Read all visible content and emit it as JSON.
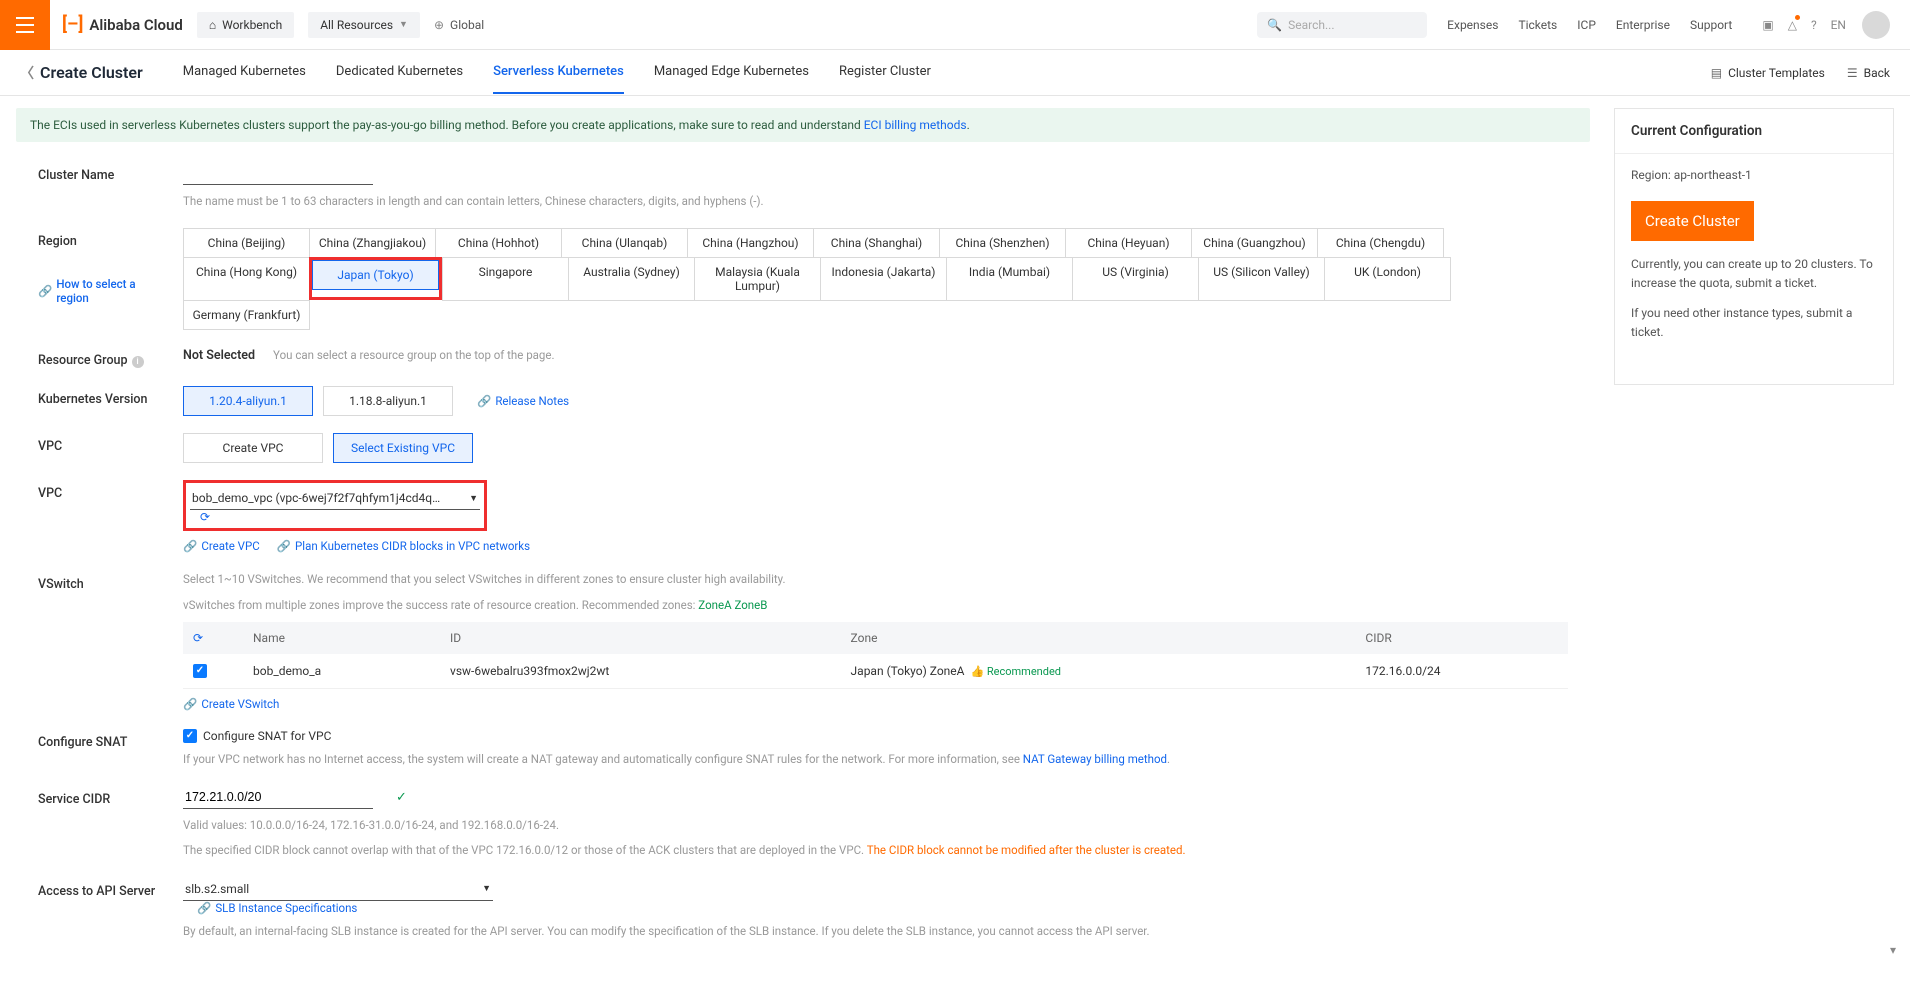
{
  "header": {
    "brand": "Alibaba Cloud",
    "workbench": "Workbench",
    "all_resources": "All Resources",
    "global": "Global",
    "search_placeholder": "Search...",
    "links": {
      "expenses": "Expenses",
      "tickets": "Tickets",
      "icp": "ICP",
      "enterprise": "Enterprise",
      "support": "Support"
    },
    "lang": "EN"
  },
  "tabbar": {
    "back_title": "Create Cluster",
    "tabs": {
      "managed": "Managed Kubernetes",
      "dedicated": "Dedicated Kubernetes",
      "serverless": "Serverless Kubernetes",
      "edge": "Managed Edge Kubernetes",
      "register": "Register Cluster"
    },
    "right": {
      "templates": "Cluster Templates",
      "back": "Back"
    }
  },
  "banner": {
    "text_pre": "The ECIs used in serverless Kubernetes clusters support the pay-as-you-go billing method. Before you create applications, make sure to read and understand ",
    "link": "ECI billing methods",
    "dot": "."
  },
  "form": {
    "cluster_name": {
      "label": "Cluster Name",
      "hint": "The name must be 1 to 63 characters in length and can contain letters, Chinese characters, digits, and hyphens (-)."
    },
    "region": {
      "label": "Region",
      "help_link": "How to select a region",
      "options": [
        "China (Beijing)",
        "China (Zhangjiakou)",
        "China (Hohhot)",
        "China (Ulanqab)",
        "China (Hangzhou)",
        "China (Shanghai)",
        "China (Shenzhen)",
        "China (Heyuan)",
        "China (Guangzhou)",
        "China (Chengdu)",
        "China (Hong Kong)",
        "Japan (Tokyo)",
        "Singapore",
        "Australia (Sydney)",
        "Malaysia (Kuala Lumpur)",
        "Indonesia (Jakarta)",
        "India (Mumbai)",
        "US (Virginia)",
        "US (Silicon Valley)",
        "UK (London)",
        "Germany (Frankfurt)"
      ],
      "selected": "Japan (Tokyo)"
    },
    "resource_group": {
      "label": "Resource Group",
      "value": "Not Selected",
      "hint": "You can select a resource group on the top of the page."
    },
    "k8s_version": {
      "label": "Kubernetes Version",
      "options": [
        "1.20.4-aliyun.1",
        "1.18.8-aliyun.1"
      ],
      "selected": "1.20.4-aliyun.1",
      "release_notes": "Release Notes"
    },
    "vpc_mode": {
      "label": "VPC",
      "options": [
        "Create VPC",
        "Select Existing VPC"
      ],
      "selected": "Select Existing VPC"
    },
    "vpc_select": {
      "label": "VPC",
      "value": "bob_demo_vpc (vpc-6wej7f2f7qhfym1j4cd4q, 172.16....",
      "create_link": "Create VPC",
      "plan_link": "Plan Kubernetes CIDR blocks in VPC networks"
    },
    "vswitch": {
      "label": "VSwitch",
      "hint1": "Select 1~10 VSwitches. We recommend that you select VSwitches in different zones to ensure cluster high availability.",
      "hint2_pre": "vSwitches from multiple zones improve the success rate of resource creation. Recommended zones: ",
      "zonea": "ZoneA",
      "zoneb": "ZoneB",
      "th_name": "Name",
      "th_id": "ID",
      "th_zone": "Zone",
      "th_cidr": "CIDR",
      "row": {
        "name": "bob_demo_a",
        "id": "vsw-6webalru393fmox2wj2wt",
        "zone": "Japan (Tokyo) ZoneA",
        "rec": "Recommended",
        "cidr": "172.16.0.0/24"
      },
      "create_link": "Create VSwitch"
    },
    "snat": {
      "label": "Configure SNAT",
      "check_label": "Configure SNAT for VPC",
      "hint_pre": "If your VPC network has no Internet access, the system will create a NAT gateway and automatically configure SNAT rules for the network. For more information, see ",
      "hint_link": "NAT Gateway billing method",
      "hint_dot": "."
    },
    "service_cidr": {
      "label": "Service CIDR",
      "value": "172.21.0.0/20",
      "hint1": "Valid values: 10.0.0.0/16-24, 172.16-31.0.0/16-24, and 192.168.0.0/16-24.",
      "hint2_pre": "The specified CIDR block cannot overlap with that of the VPC 172.16.0.0/12 or those of the ACK clusters that are deployed in the VPC. ",
      "hint2_orange": "The CIDR block cannot be modified after the cluster is created."
    },
    "api_server": {
      "label": "Access to API Server",
      "value": "slb.s2.small",
      "spec_link": "SLB Instance Specifications",
      "hint": "By default, an internal-facing SLB instance is created for the API server. You can modify the specification of the SLB instance. If you delete the SLB instance, you cannot access the API server."
    }
  },
  "side": {
    "title": "Current Configuration",
    "region_label": "Region: ",
    "region_value": "ap-northeast-1",
    "create_btn": "Create Cluster",
    "note1": "Currently, you can create up to 20 clusters. To increase the quota, submit a ticket.",
    "note2": "If you need other instance types, submit a ticket."
  }
}
